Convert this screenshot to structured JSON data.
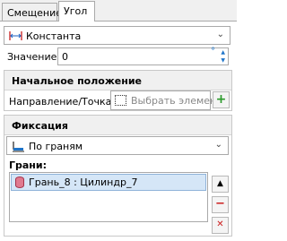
{
  "tabs": [
    {
      "label": "Смещение",
      "active": false
    },
    {
      "label": "Угол",
      "active": true
    }
  ],
  "type_select": {
    "value": "Константа"
  },
  "value_field": {
    "label": "Значение:",
    "value": "0",
    "unit": "°"
  },
  "initial_position": {
    "title": "Начальное положение",
    "direction_label": "Направление/Точка:",
    "select_placeholder": "Выбрать элемент",
    "add_label": "+"
  },
  "fixation": {
    "title": "Фиксация",
    "mode_select": {
      "value": "По граням"
    },
    "faces_label": "Грани:",
    "faces": [
      "Грань_8 : Цилиндр_7"
    ],
    "buttons": {
      "up": "▲",
      "remove": "−",
      "clear": "✕"
    }
  },
  "colors": {
    "accent": "#1e74c9",
    "remove": "#cc1f1f",
    "add": "#2a9a2a",
    "selection": "#d5e6f7"
  }
}
